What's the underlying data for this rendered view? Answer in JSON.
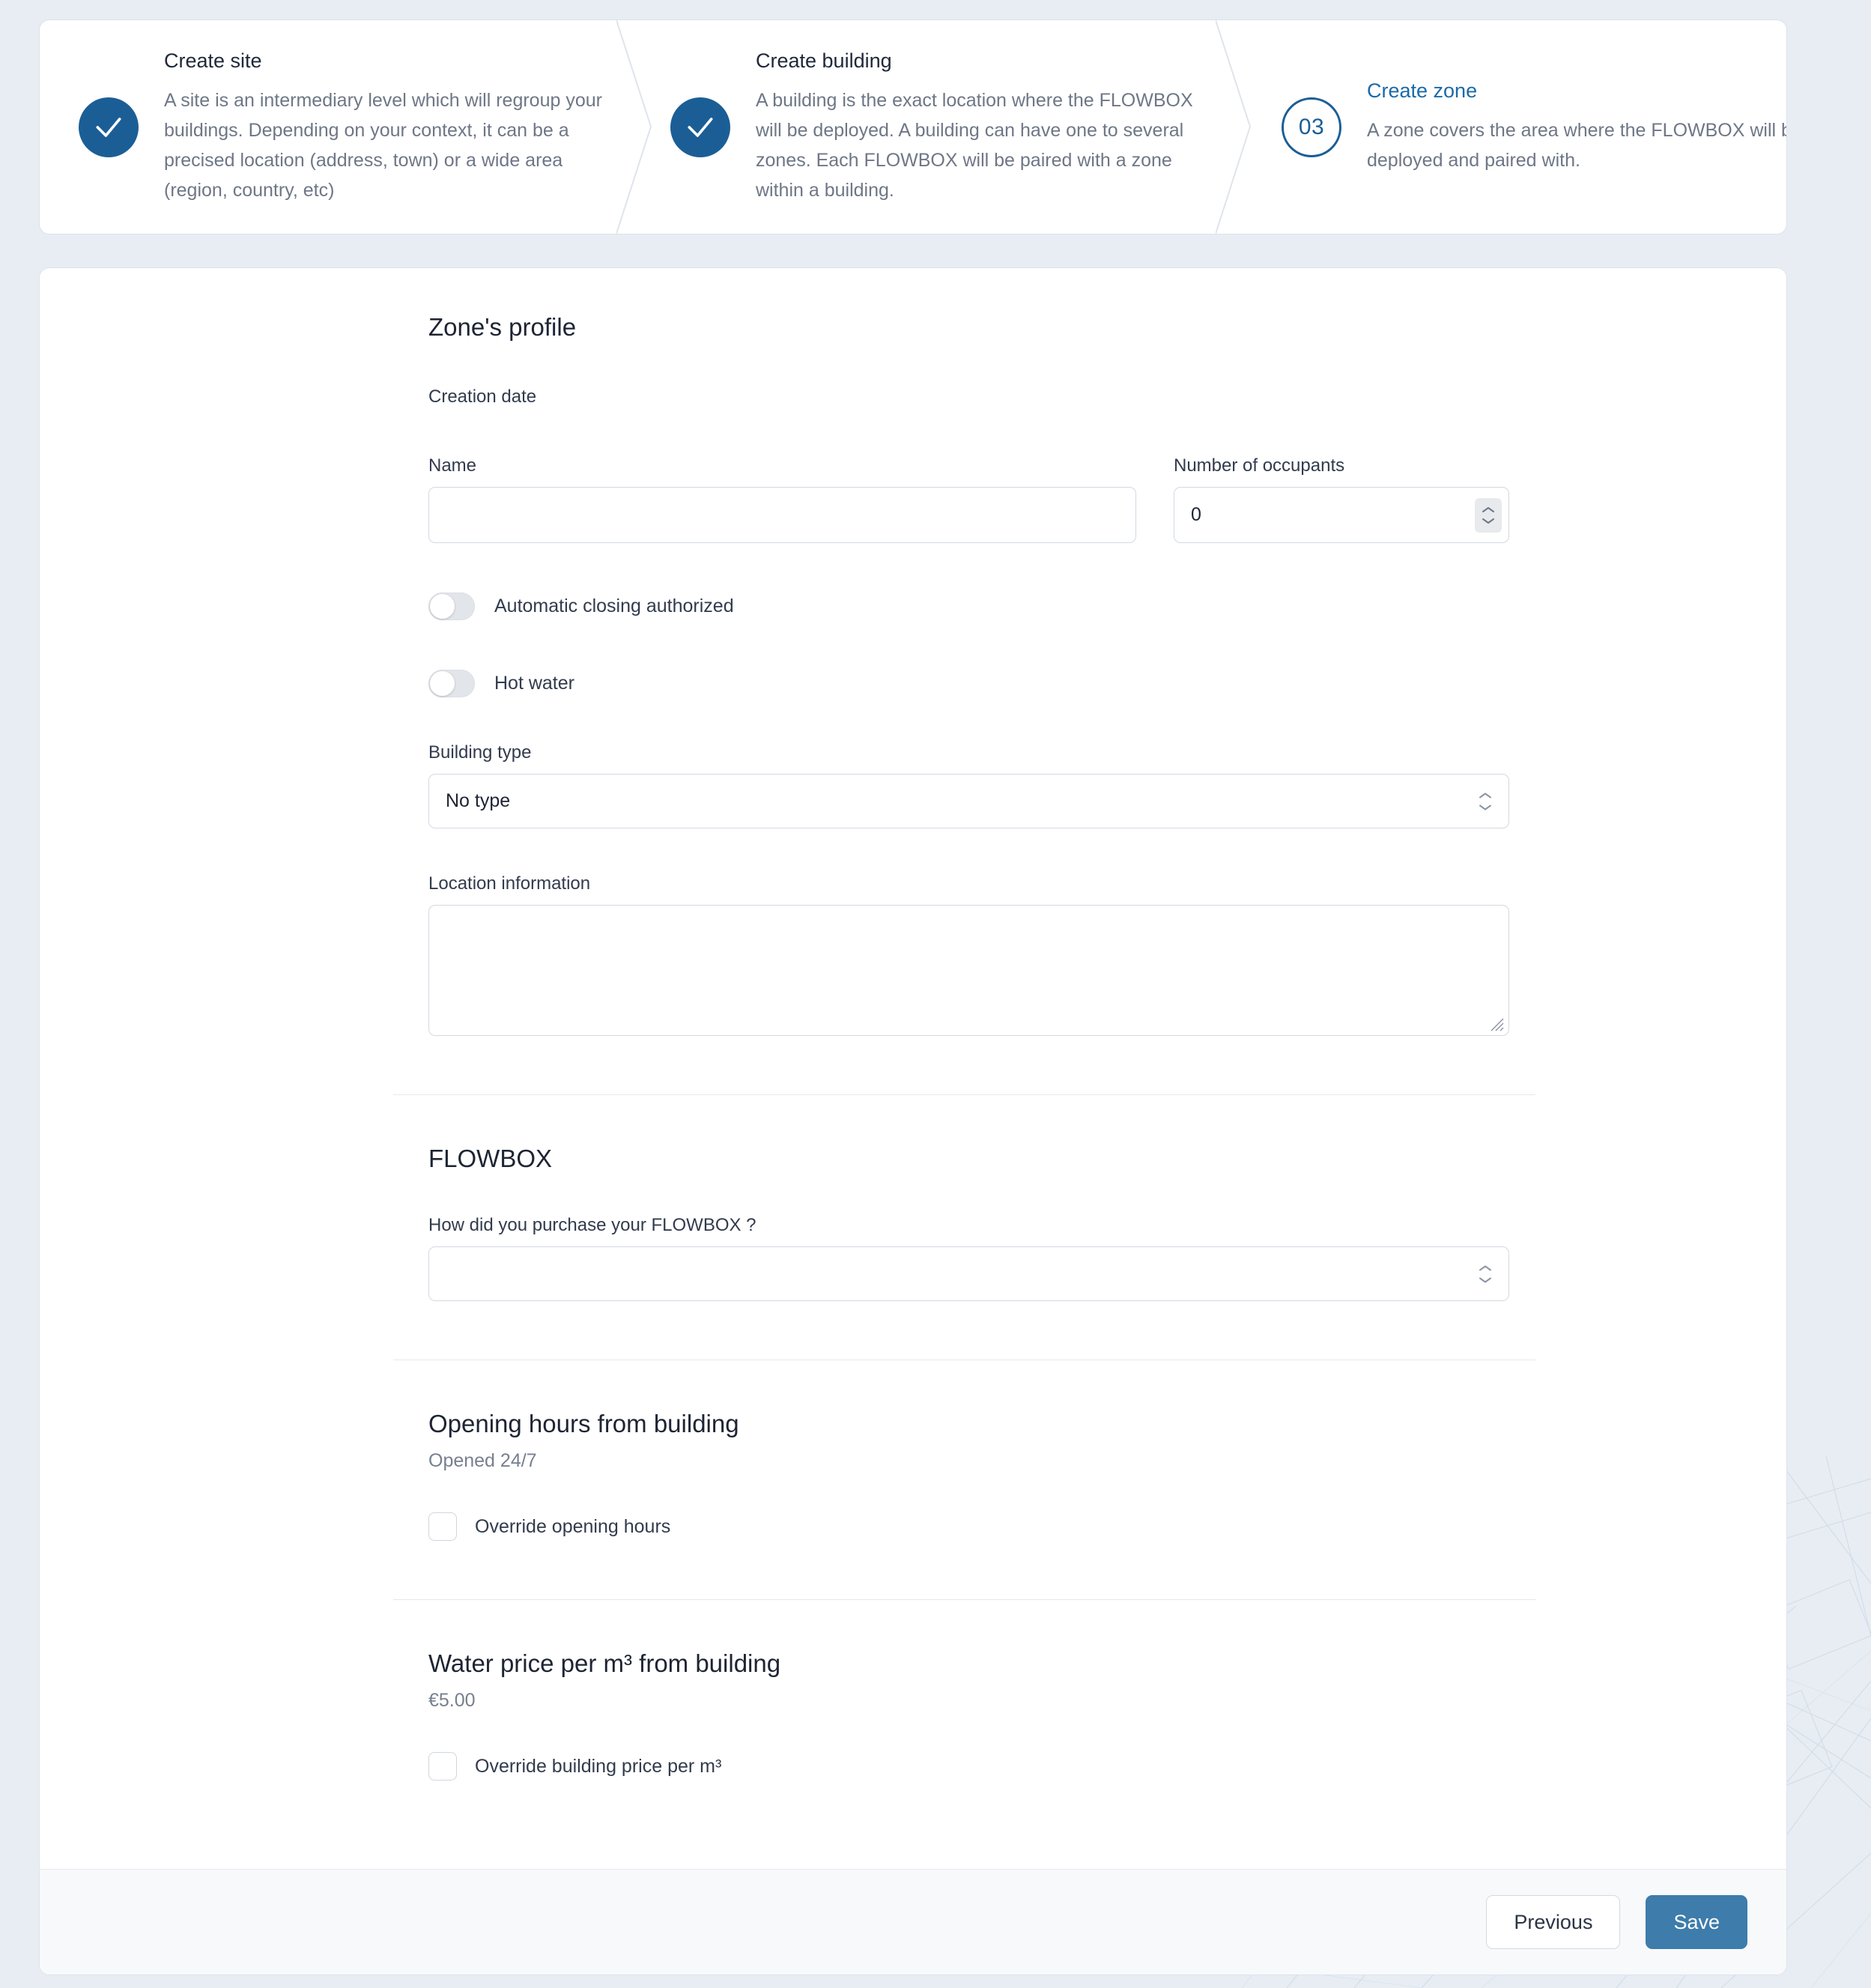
{
  "stepper": {
    "steps": [
      {
        "marker": "check",
        "number": "",
        "title": "Create site",
        "desc": "A site is an intermediary level which will regroup your buildings. Depending on your context, it can be a precised location (address, town) or a wide area (region, country, etc)",
        "state": "done"
      },
      {
        "marker": "check",
        "number": "",
        "title": "Create building",
        "desc": "A building is the exact location where the FLOWBOX will be deployed. A building can have one to several zones. Each FLOWBOX will be paired with a zone within a building.",
        "state": "done"
      },
      {
        "marker": "number",
        "number": "03",
        "title": "Create zone",
        "desc": "A zone covers the area where the FLOWBOX will be deployed and paired with.",
        "state": "current"
      }
    ]
  },
  "form": {
    "title": "Zone's profile",
    "creation_date_label": "Creation date",
    "name": {
      "label": "Name",
      "value": "",
      "placeholder": ""
    },
    "occupants": {
      "label": "Number of occupants",
      "value": "0"
    },
    "toggles": [
      {
        "label": "Automatic closing authorized",
        "checked": false
      },
      {
        "label": "Hot water",
        "checked": false
      }
    ],
    "building_type": {
      "label": "Building type",
      "value": "No type",
      "options": [
        "No type"
      ]
    },
    "location_information": {
      "label": "Location information",
      "value": ""
    }
  },
  "flowbox": {
    "title": "FLOWBOX",
    "purchase": {
      "label": "How did you purchase your FLOWBOX ?",
      "value": "",
      "options": []
    }
  },
  "opening_hours": {
    "title": "Opening hours from building",
    "value": "Opened 24/7",
    "override_label": "Override opening hours",
    "override_checked": false
  },
  "water_price": {
    "title": "Water price per m³ from building",
    "value": "€5.00",
    "override_label": "Override building price per m³",
    "override_checked": false
  },
  "footer": {
    "previous_label": "Previous",
    "save_label": "Save"
  },
  "colors": {
    "page_bg": "#e7edf3",
    "accent_blue": "#1b5e96",
    "link_blue": "#1b6aa8",
    "primary_button": "#3d7cab",
    "text_dark": "#1d2433",
    "text_muted": "#6e7786",
    "border": "#d3d9e2"
  }
}
